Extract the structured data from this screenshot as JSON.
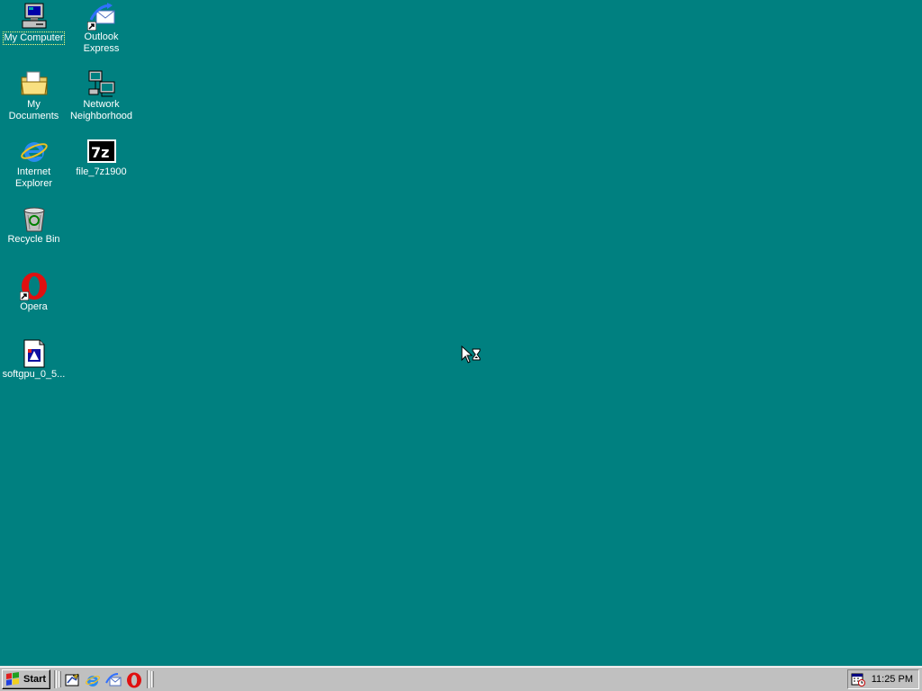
{
  "desktop": {
    "background_color": "#008080",
    "icons": [
      {
        "label": "My Computer",
        "icon": "my-computer-icon",
        "selected": true
      },
      {
        "label": "Outlook\nExpress",
        "icon": "outlook-express-icon"
      },
      {
        "label": "My Documents",
        "icon": "my-documents-icon"
      },
      {
        "label": "Network\nNeighborhood",
        "icon": "network-neighborhood-icon"
      },
      {
        "label": "Internet\nExplorer",
        "icon": "internet-explorer-icon"
      },
      {
        "label": "file_7z1900",
        "icon": "7zip-icon"
      },
      {
        "label": "Recycle Bin",
        "icon": "recycle-bin-icon"
      },
      {
        "label": "Opera",
        "icon": "opera-icon"
      },
      {
        "label": "softgpu_0_5...",
        "icon": "installer-icon"
      }
    ]
  },
  "taskbar": {
    "start_label": "Start",
    "quick_launch": [
      "show-desktop-icon",
      "internet-explorer-icon",
      "outlook-express-icon",
      "opera-icon"
    ],
    "clock": "11:25 PM",
    "tray_icon": "scheduler-icon"
  }
}
